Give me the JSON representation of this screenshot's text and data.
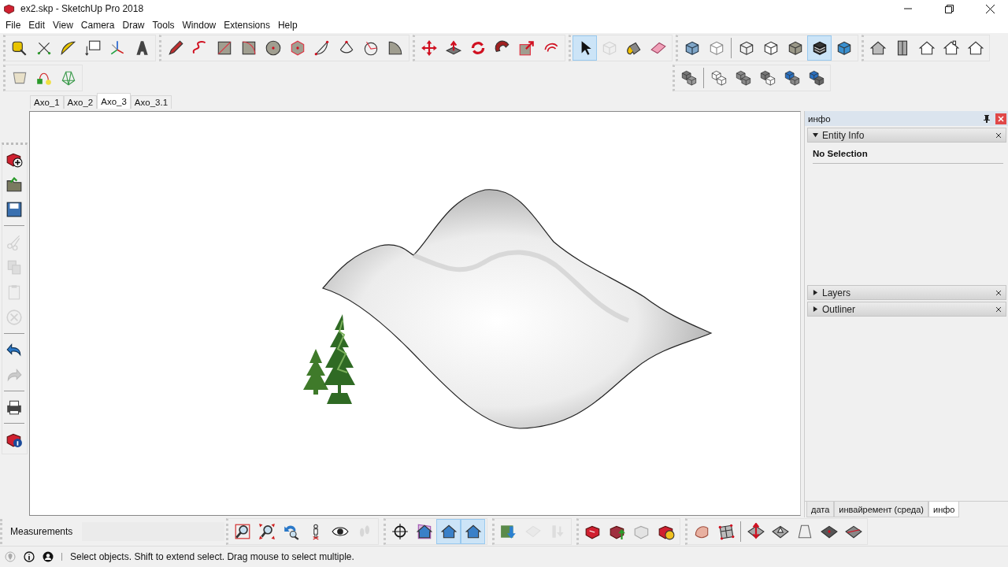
{
  "window": {
    "title": "ex2.skp - SketchUp Pro 2018"
  },
  "menu": [
    "File",
    "Edit",
    "View",
    "Camera",
    "Draw",
    "Tools",
    "Window",
    "Extensions",
    "Help"
  ],
  "toolbar_rows": [
    [
      {
        "buttons": [
          {
            "selected": false,
            "disabled": false
          },
          {
            "selected": false,
            "disabled": false
          },
          {
            "selected": false,
            "disabled": false
          },
          {
            "selected": false,
            "disabled": false
          },
          {
            "selected": false,
            "disabled": false
          },
          {
            "selected": false,
            "disabled": false
          }
        ]
      },
      {
        "buttons": [
          {
            "selected": false,
            "disabled": false
          },
          {
            "selected": false,
            "disabled": false
          },
          {
            "selected": false,
            "disabled": false
          },
          {
            "selected": false,
            "disabled": false
          },
          {
            "selected": false,
            "disabled": false
          },
          {
            "selected": false,
            "disabled": false
          },
          {
            "selected": false,
            "disabled": false
          },
          {
            "selected": false,
            "disabled": false
          },
          {
            "selected": false,
            "disabled": false
          },
          {
            "selected": false,
            "disabled": false
          }
        ]
      },
      {
        "buttons": [
          {
            "selected": false,
            "disabled": false
          },
          {
            "selected": false,
            "disabled": false
          },
          {
            "selected": false,
            "disabled": false
          },
          {
            "selected": false,
            "disabled": false
          },
          {
            "selected": false,
            "disabled": false
          },
          {
            "selected": false,
            "disabled": false
          }
        ]
      },
      {
        "buttons": [
          {
            "selected": true,
            "disabled": false
          },
          {
            "selected": false,
            "disabled": true
          },
          {
            "selected": false,
            "disabled": false
          },
          {
            "selected": false,
            "disabled": false
          }
        ]
      },
      {
        "buttons": [
          {
            "selected": false,
            "disabled": false
          },
          {
            "selected": false,
            "disabled": false
          },
          {
            "selected": false,
            "disabled": false
          },
          {
            "selected": false,
            "disabled": false
          },
          {
            "selected": false,
            "disabled": false
          },
          {
            "selected": true,
            "disabled": false
          },
          {
            "selected": false,
            "disabled": false
          }
        ]
      },
      {
        "buttons": [
          {
            "selected": false,
            "disabled": false
          },
          {
            "selected": false,
            "disabled": false
          },
          {
            "selected": false,
            "disabled": false
          },
          {
            "selected": false,
            "disabled": false
          },
          {
            "selected": false,
            "disabled": false
          }
        ]
      }
    ],
    [
      {
        "buttons": [
          {
            "selected": false,
            "disabled": false
          },
          {
            "selected": false,
            "disabled": false
          },
          {
            "selected": false,
            "disabled": false
          }
        ]
      },
      {
        "buttons": [
          {
            "selected": false,
            "disabled": false
          },
          {
            "selected": false,
            "disabled": false
          },
          {
            "selected": false,
            "disabled": false
          },
          {
            "selected": false,
            "disabled": false
          },
          {
            "selected": false,
            "disabled": false
          },
          {
            "selected": false,
            "disabled": false
          }
        ]
      }
    ]
  ],
  "scene_tabs": [
    {
      "label": "Axo_1",
      "selected": false
    },
    {
      "label": "Axo_2",
      "selected": false
    },
    {
      "label": "Axo_3",
      "selected": true
    },
    {
      "label": "Axo_3.1",
      "selected": false
    }
  ],
  "side_toolbar": {
    "buttons": [
      {
        "selected": false,
        "disabled": false
      },
      {
        "selected": false,
        "disabled": false
      },
      {
        "selected": false,
        "disabled": false
      },
      {
        "selected": false,
        "disabled": true
      },
      {
        "selected": false,
        "disabled": true
      },
      {
        "selected": false,
        "disabled": true
      },
      {
        "selected": false,
        "disabled": true
      },
      {
        "selected": false,
        "disabled": false
      },
      {
        "selected": false,
        "disabled": true
      },
      {
        "selected": false,
        "disabled": false
      },
      {
        "selected": false,
        "disabled": false
      }
    ]
  },
  "tray": {
    "title": "инфо",
    "sections": [
      {
        "title": "Entity Info",
        "expanded": true,
        "content": "No Selection"
      },
      {
        "title": "Layers",
        "expanded": false
      },
      {
        "title": "Outliner",
        "expanded": false
      }
    ],
    "tabs": [
      {
        "label": "дата",
        "selected": false
      },
      {
        "label": "инвайремент (среда)",
        "selected": false
      },
      {
        "label": "инфо",
        "selected": true
      }
    ]
  },
  "measurements": {
    "label": "Measurements"
  },
  "bottom_toolbars": [
    {
      "buttons": [
        {
          "selected": false,
          "disabled": false
        },
        {
          "selected": false,
          "disabled": false
        },
        {
          "selected": false,
          "disabled": false
        },
        {
          "selected": false,
          "disabled": false
        },
        {
          "selected": false,
          "disabled": false
        },
        {
          "selected": false,
          "disabled": true
        }
      ]
    },
    {
      "buttons": [
        {
          "selected": false,
          "disabled": false
        },
        {
          "selected": false,
          "disabled": false
        },
        {
          "selected": true,
          "disabled": false
        },
        {
          "selected": true,
          "disabled": false
        }
      ]
    },
    {
      "buttons": [
        {
          "selected": false,
          "disabled": false
        },
        {
          "selected": false,
          "disabled": true
        },
        {
          "selected": false,
          "disabled": true
        }
      ]
    },
    {
      "buttons": [
        {
          "selected": false,
          "disabled": false
        },
        {
          "selected": false,
          "disabled": false
        },
        {
          "selected": false,
          "disabled": true
        },
        {
          "selected": false,
          "disabled": false
        }
      ]
    },
    {
      "buttons": [
        {
          "selected": false,
          "disabled": false
        },
        {
          "selected": false,
          "disabled": false
        },
        {
          "selected": false,
          "disabled": false
        },
        {
          "selected": false,
          "disabled": false
        },
        {
          "selected": false,
          "disabled": false
        },
        {
          "selected": false,
          "disabled": false
        },
        {
          "selected": false,
          "disabled": false
        }
      ]
    }
  ],
  "status_bar": {
    "message": "Select objects. Shift to extend select. Drag mouse to select multiple."
  }
}
